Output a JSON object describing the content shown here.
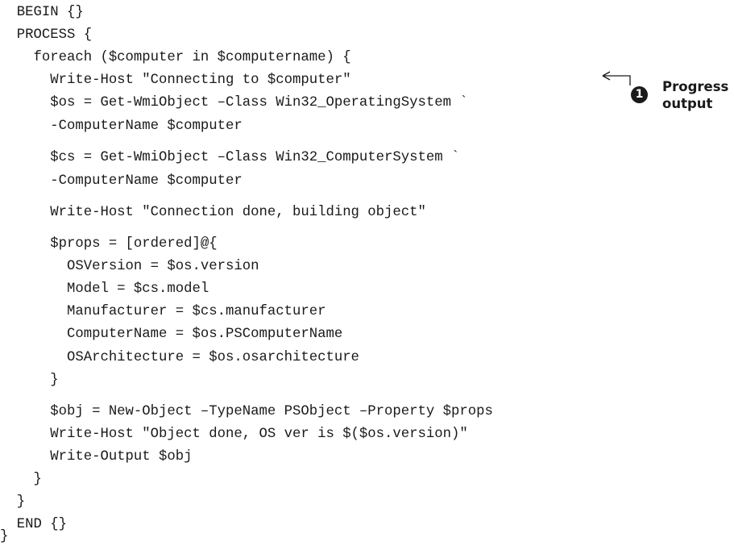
{
  "code": {
    "lines": [
      "  BEGIN {}",
      "  PROCESS {",
      "    foreach ($computer in $computername) {",
      "      Write-Host \"Connecting to $computer\"",
      "      $os = Get-WmiObject –Class Win32_OperatingSystem `",
      "      -ComputerName $computer",
      "      $cs = Get-WmiObject –Class Win32_ComputerSystem `",
      "      -ComputerName $computer",
      "      Write-Host \"Connection done, building object\"",
      "      $props = [ordered]@{",
      "        OSVersion = $os.version",
      "        Model = $cs.model",
      "        Manufacturer = $cs.manufacturer",
      "        ComputerName = $os.PSComputerName",
      "        OSArchitecture = $os.osarchitecture",
      "      }",
      "      $obj = New-Object –TypeName PSObject –Property $props",
      "      Write-Host \"Object done, OS ver is $($os.version)\"",
      "      Write-Output $obj",
      "    }",
      "  }",
      "  END {}",
      "}"
    ]
  },
  "annotation": {
    "number": "1",
    "label_line1": "Progress",
    "label_line2": "output"
  }
}
